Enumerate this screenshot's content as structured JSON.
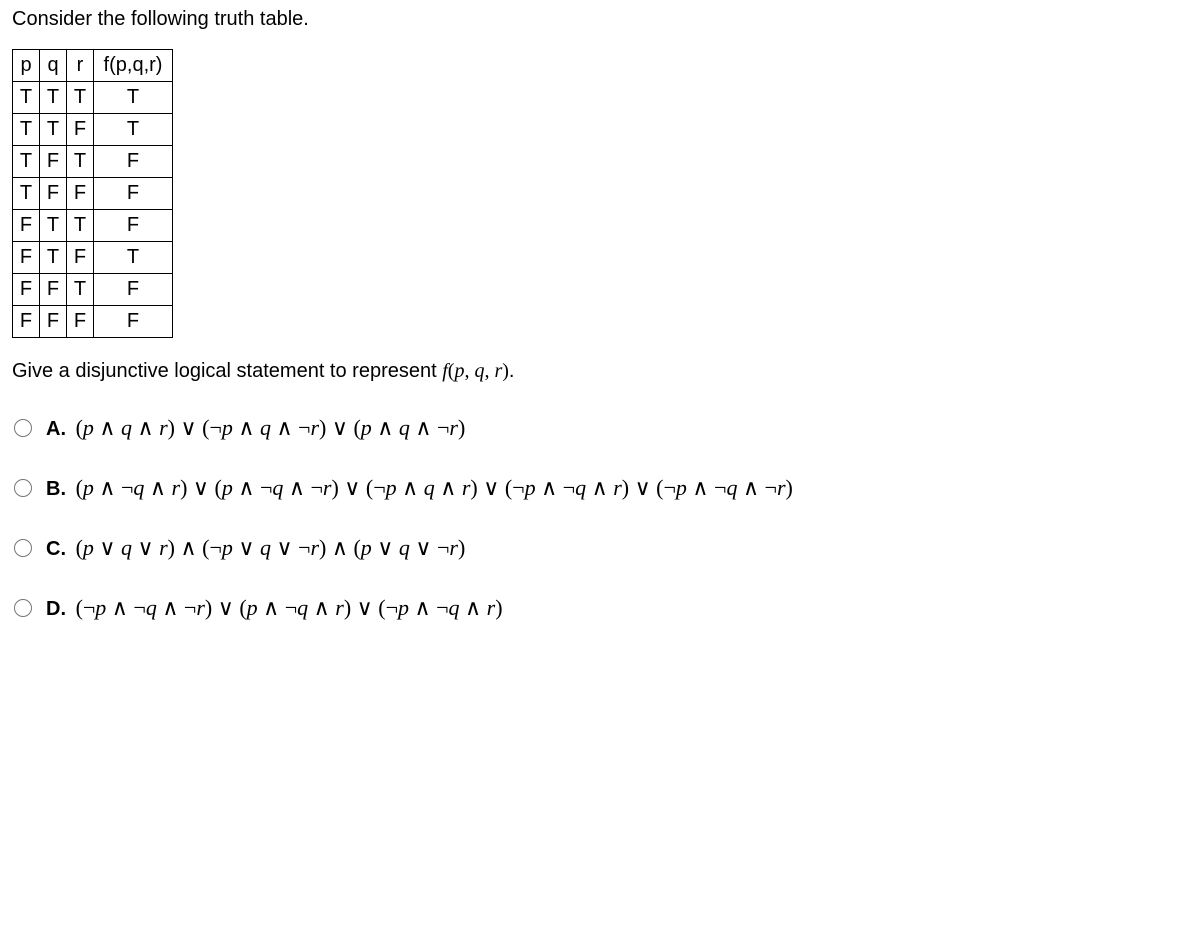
{
  "intro_text": "Consider the following truth table.",
  "table": {
    "header": {
      "p": "p",
      "q": "q",
      "r": "r",
      "f": "f(p,q,r)"
    },
    "rows": [
      {
        "p": "T",
        "q": "T",
        "r": "T",
        "f": "T"
      },
      {
        "p": "T",
        "q": "T",
        "r": "F",
        "f": "T"
      },
      {
        "p": "T",
        "q": "F",
        "r": "T",
        "f": "F"
      },
      {
        "p": "T",
        "q": "F",
        "r": "F",
        "f": "F"
      },
      {
        "p": "F",
        "q": "T",
        "r": "T",
        "f": "F"
      },
      {
        "p": "F",
        "q": "T",
        "r": "F",
        "f": "T"
      },
      {
        "p": "F",
        "q": "F",
        "r": "T",
        "f": "F"
      },
      {
        "p": "F",
        "q": "F",
        "r": "F",
        "f": "F"
      }
    ]
  },
  "prompt_prefix": "Give a disjunctive logical statement to represent ",
  "prompt_func": "f(p, q, r)",
  "prompt_suffix": ".",
  "options": {
    "A": {
      "letter": "A.",
      "expr": "(p ∧ q ∧ r) ∨ (¬p ∧ q ∧ ¬r) ∨ (p ∧ q ∧ ¬r)"
    },
    "B": {
      "letter": "B.",
      "expr": "(p ∧ ¬q ∧ r) ∨ (p ∧ ¬q ∧ ¬r) ∨ (¬p ∧ q ∧ r) ∨ (¬p ∧ ¬q ∧ r) ∨ (¬p ∧ ¬q ∧ ¬r)"
    },
    "C": {
      "letter": "C.",
      "expr": "(p ∨ q ∨ r) ∧ (¬p ∨ q ∨ ¬r) ∧ (p ∨ q ∨ ¬r)"
    },
    "D": {
      "letter": "D.",
      "expr": "(¬p ∧ ¬q ∧ ¬r) ∨ (p ∧ ¬q ∧ r) ∨ (¬p ∧ ¬q ∧ r)"
    }
  }
}
